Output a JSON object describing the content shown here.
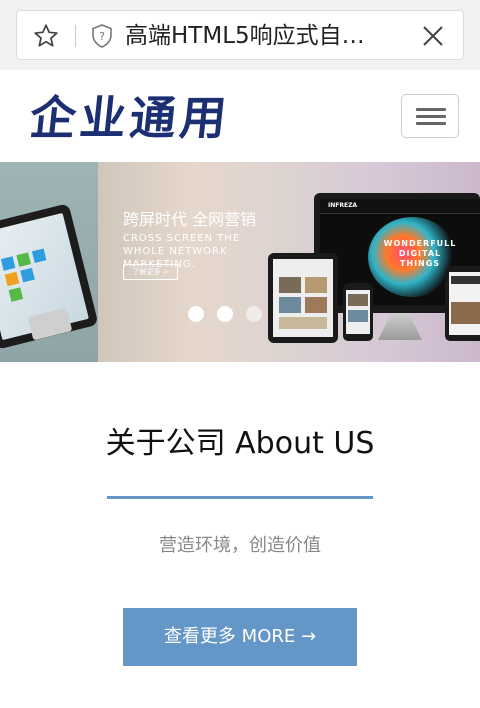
{
  "browser": {
    "url_title": "高端HTML5响应式自…"
  },
  "site": {
    "logo_text": "企业通用"
  },
  "banner": {
    "headline": "跨屏时代  全网营销",
    "subline": "CROSS SCREEN THE WHOLE NETWORK MARKETING.",
    "button_label": "了解更多 >",
    "monitor_brand": "INFREZA",
    "monitor_headline": "WONDERFULL DIGITAL THINGS",
    "slide_count": 3,
    "active_slide": 1
  },
  "about": {
    "title": "关于公司 About US",
    "subtitle": "营造环境，创造价值",
    "more_button": "查看更多 MORE →"
  },
  "colors": {
    "logo": "#1d2f73",
    "accent": "#6496c8",
    "rule": "#6796c6"
  },
  "icons": {
    "star": "star-icon",
    "shield": "shield-icon",
    "close": "close-icon",
    "menu": "hamburger-icon"
  }
}
